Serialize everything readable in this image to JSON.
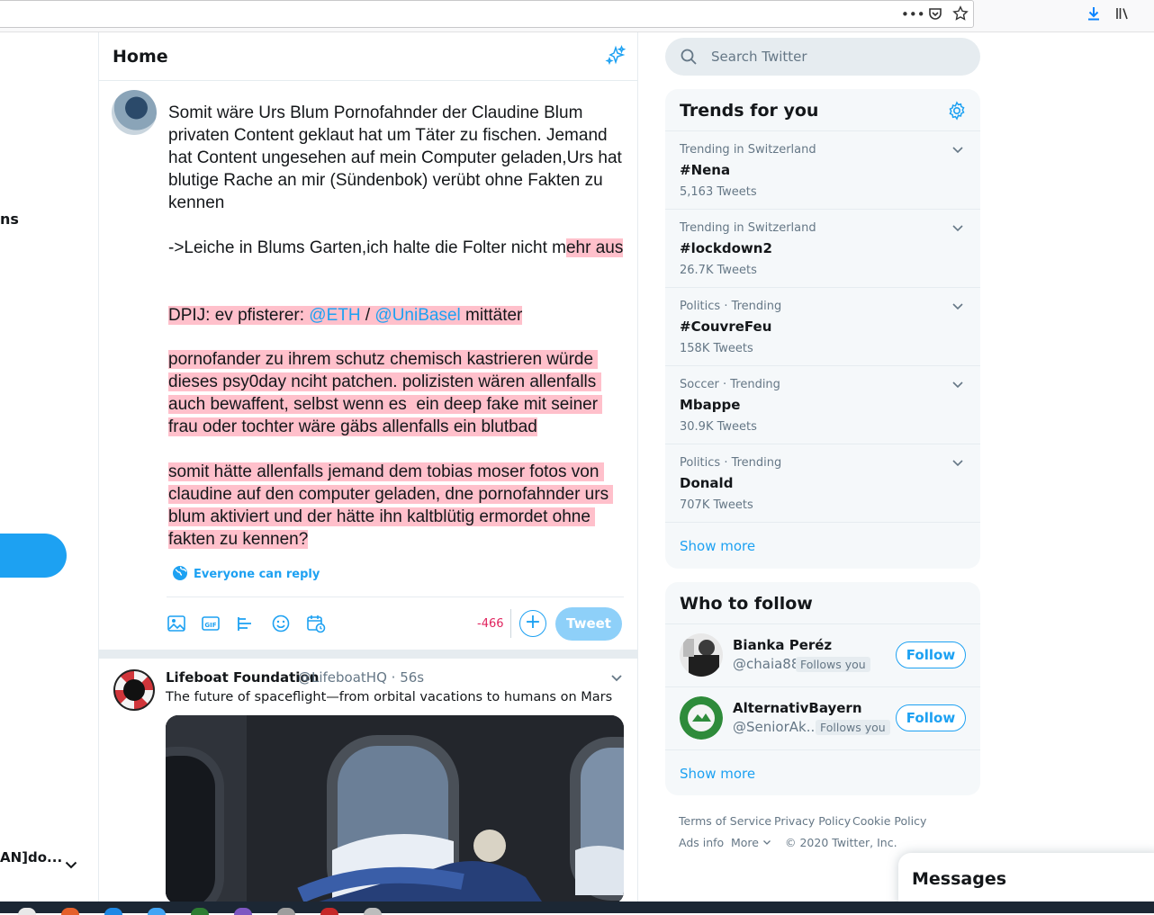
{
  "left": {
    "partial_nav_text": "ns",
    "partial_account_text": "AN]do..."
  },
  "main": {
    "title": "Home",
    "compose": {
      "line1": "Somit wäre Urs Blum Pornofahnder der Claudine Blum privaten Content geklaut hat um Täter zu fischen. Jemand hat Content ungesehen auf mein Computer geladen,Urs hat blutige Rache an mir (Sündenbok) verübt ohne Fakten zu kennen",
      "line2_plain": "->Leiche in Blums Garten,ich halte die Folter nicht m",
      "line2_hl": "ehr aus",
      "dpij_prefix": "DPIJ: ev pfisterer: ",
      "mention1": "@ETH",
      "slash": " / ",
      "mention2": "@UniBasel",
      "dpij_suffix": " mittäter",
      "para3": "pornofander zu ihrem schutz chemisch kastrieren würde dieses psy0day nciht patchen. polizisten wären allenfalls auch bewaffent, selbst wenn es  ein deep fake mit seiner frau oder tochter wäre gäbs allenfalls ein blutbad",
      "para4": "somit hätte allenfalls jemand dem tobias moser fotos von claudine auf den computer geladen, dne pornofahnder urs blum aktiviert und der hätte ihn kaltblütig ermordet ohne fakten zu kennen?"
    },
    "reply_setting": "Everyone can reply",
    "char_count": "-466",
    "tweet_button": "Tweet",
    "feed_tweet": {
      "name": "Lifeboat Foundation",
      "handle": "@LifeboatHQ · 56s",
      "text": "The future of spaceflight—from orbital vacations to humans on Mars"
    }
  },
  "search": {
    "placeholder": "Search Twitter"
  },
  "trends": {
    "title": "Trends for you",
    "items": [
      {
        "meta": "Trending in Switzerland",
        "name": "#Nena",
        "count": "5,163 Tweets"
      },
      {
        "meta": "Trending in Switzerland",
        "name": "#lockdown2",
        "count": "26.7K Tweets"
      },
      {
        "meta": "Politics · Trending",
        "name": "#CouvreFeu",
        "count": "158K Tweets"
      },
      {
        "meta": "Soccer · Trending",
        "name": "Mbappe",
        "count": "30.9K Tweets"
      },
      {
        "meta": "Politics · Trending",
        "name": "Donald",
        "count": "707K Tweets"
      }
    ],
    "show_more": "Show more"
  },
  "who_to_follow": {
    "title": "Who to follow",
    "users": [
      {
        "name": "Bianka Peréz",
        "handle": "@chaia88",
        "badge": "Follows you",
        "button": "Follow"
      },
      {
        "name": "AlternativBayern",
        "handle": "@SeniorAk...",
        "badge": "Follows you",
        "button": "Follow"
      }
    ],
    "show_more": "Show more"
  },
  "footer": {
    "terms": "Terms of Service",
    "privacy": "Privacy Policy",
    "cookie": "Cookie Policy",
    "ads": "Ads info",
    "more": "More",
    "copyright": "© 2020 Twitter, Inc."
  },
  "messages": {
    "title": "Messages"
  },
  "colors": {
    "accent": "#1da1f2",
    "highlight": "#ffc0cb",
    "error": "#e0245e"
  }
}
